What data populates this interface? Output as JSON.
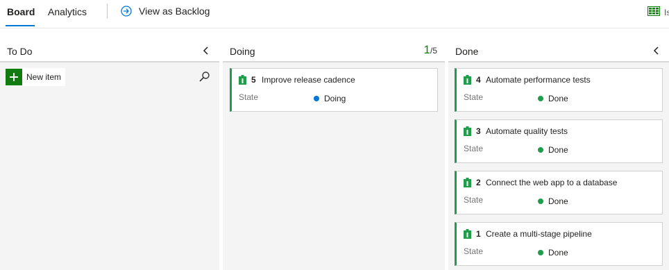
{
  "nav": {
    "tabs": [
      {
        "label": "Board",
        "active": true
      },
      {
        "label": "Analytics",
        "active": false
      }
    ],
    "backlog_link": "View as Backlog",
    "right_text": "Is"
  },
  "colors": {
    "accent": "#0078d4",
    "card_border": "#1f9d4a",
    "doing_dot": "#0078d4",
    "done_dot": "#1f9d4a",
    "wip_count": "#107c10"
  },
  "columns": {
    "todo": {
      "title": "To Do",
      "new_item_label": "New item"
    },
    "doing": {
      "title": "Doing",
      "wip_current": "1",
      "wip_limit": "/5",
      "cards": [
        {
          "id": "5",
          "title": "Improve release cadence",
          "field_label": "State",
          "state": "Doing"
        }
      ]
    },
    "done": {
      "title": "Done",
      "cards": [
        {
          "id": "4",
          "title": "Automate performance tests",
          "field_label": "State",
          "state": "Done"
        },
        {
          "id": "3",
          "title": "Automate quality tests",
          "field_label": "State",
          "state": "Done"
        },
        {
          "id": "2",
          "title": "Connect the web app to a database",
          "field_label": "State",
          "state": "Done"
        },
        {
          "id": "1",
          "title": "Create a multi-stage pipeline",
          "field_label": "State",
          "state": "Done"
        }
      ]
    }
  }
}
